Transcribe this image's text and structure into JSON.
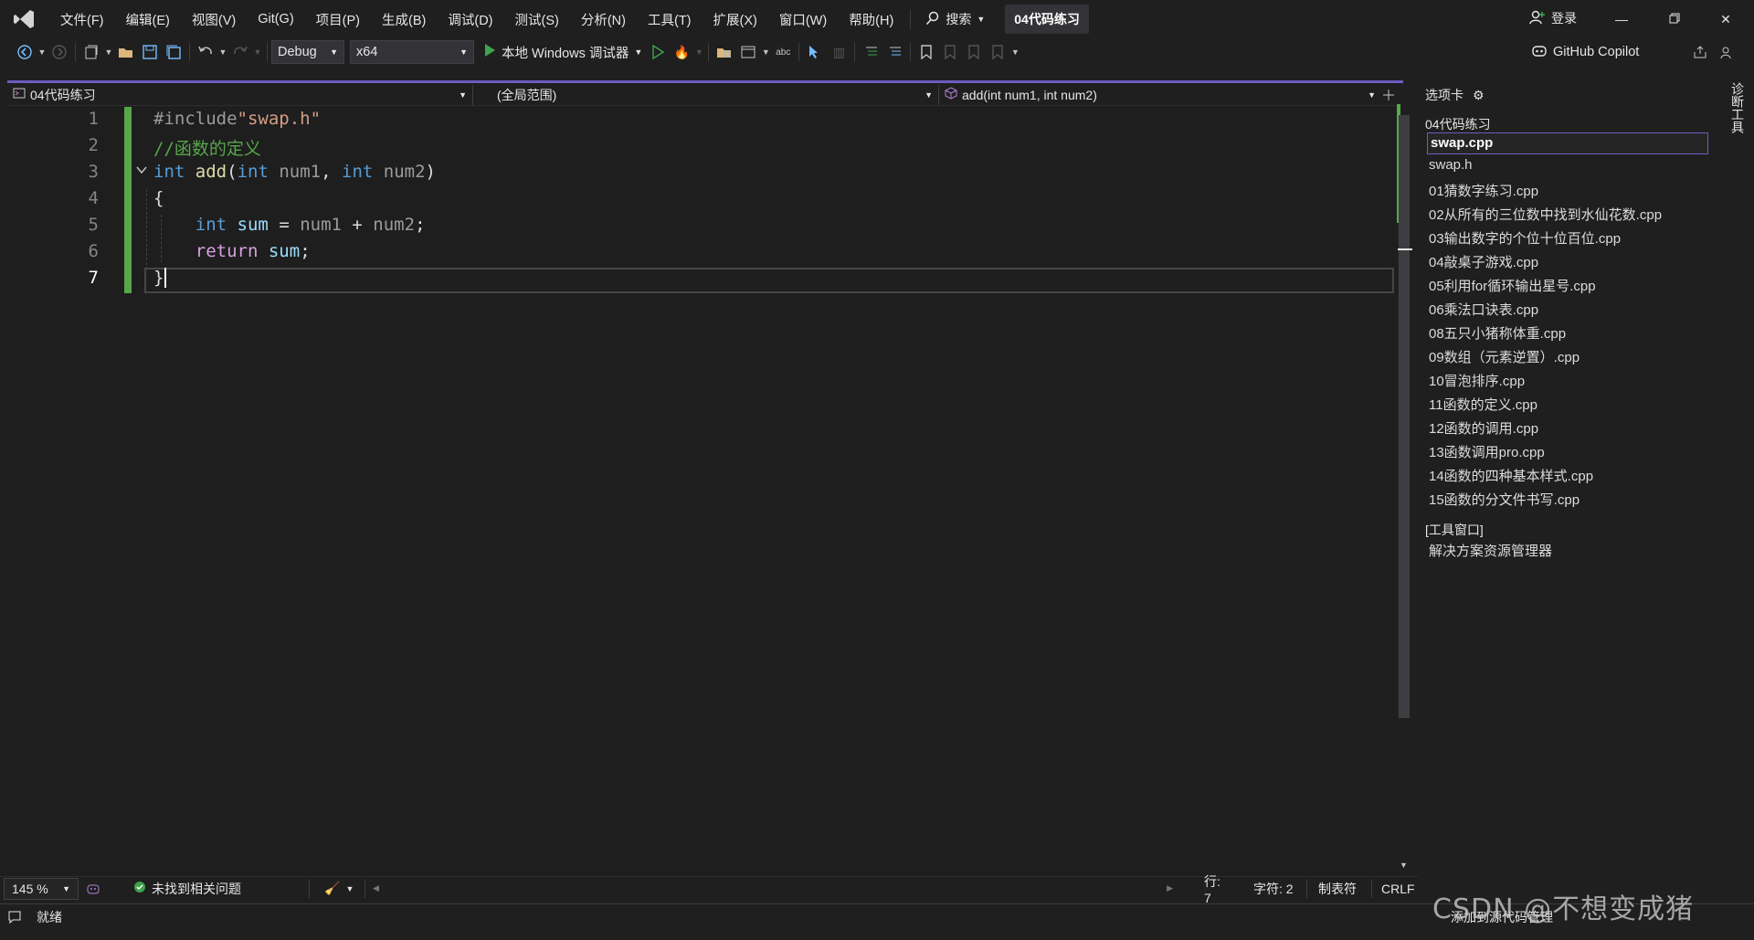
{
  "menubar": {
    "items": [
      "文件(F)",
      "编辑(E)",
      "视图(V)",
      "Git(G)",
      "项目(P)",
      "生成(B)",
      "调试(D)",
      "测试(S)",
      "分析(N)",
      "工具(T)",
      "扩展(X)",
      "窗口(W)",
      "帮助(H)"
    ],
    "search_label": "搜索",
    "solution_title": "04代码练习",
    "login_label": "登录"
  },
  "toolbar": {
    "config": "Debug",
    "platform": "x64",
    "run_label": "本地 Windows 调试器",
    "copilot_label": "GitHub Copilot"
  },
  "navbar": {
    "project": "04代码练习",
    "scope": "(全局范围)",
    "member": "add(int num1, int num2)"
  },
  "editor": {
    "line_numbers": [
      "1",
      "2",
      "3",
      "4",
      "5",
      "6",
      "7"
    ],
    "current_line": "7"
  },
  "right_panel": {
    "header": "选项卡",
    "group_label": "04代码练习",
    "files": [
      "swap.cpp",
      "swap.h",
      "01猜数字练习.cpp",
      "02从所有的三位数中找到水仙花数.cpp",
      "03输出数字的个位十位百位.cpp",
      "04敲桌子游戏.cpp",
      "05利用for循环输出星号.cpp",
      "06乘法口诀表.cpp",
      "08五只小猪称体重.cpp",
      "09数组（元素逆置）.cpp",
      "10冒泡排序.cpp",
      "11函数的定义.cpp",
      "12函数的调用.cpp",
      "13函数调用pro.cpp",
      "14函数的四种基本样式.cpp",
      "15函数的分文件书写.cpp"
    ],
    "tool_group": "[工具窗口]",
    "tool_items": [
      "解决方案资源管理器"
    ],
    "vertical_tab": "诊断工具"
  },
  "editor_status": {
    "zoom": "145 %",
    "issues": "未找到相关问题",
    "line": "行: 7",
    "col": "字符: 2",
    "tabs": "制表符",
    "eol": "CRLF"
  },
  "statusbar": {
    "ready": "就绪",
    "add_source": "添加到源代码管理"
  },
  "watermark": "CSDN @不想变成猪",
  "colors": {
    "accent": "#6e5bbf",
    "change_bar": "#57a64a",
    "keyword": "#569cd6",
    "comment": "#57a64a",
    "string": "#d69d85"
  }
}
